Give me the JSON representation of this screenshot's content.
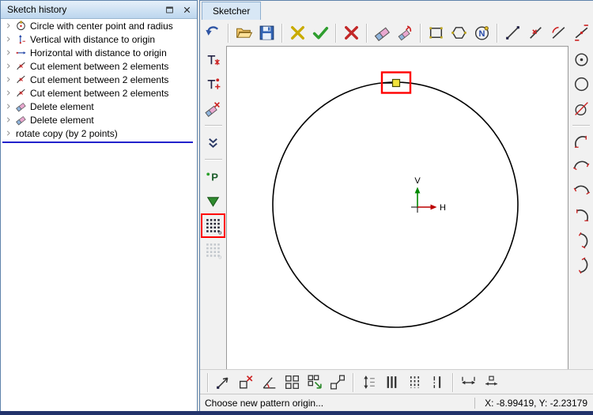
{
  "sketch_history": {
    "title": "Sketch history",
    "row_expand_icon": "expand-arrow",
    "window_buttons": [
      {
        "icon": "maximize"
      },
      {
        "icon": "close"
      }
    ],
    "items": [
      {
        "icon": "history-circle",
        "label": "Circle with center point and radius"
      },
      {
        "icon": "history-vertical",
        "label": "Vertical with distance to origin"
      },
      {
        "icon": "history-horizontal",
        "label": "Horizontal with distance to origin"
      },
      {
        "icon": "history-cut",
        "label": "Cut element between 2 elements"
      },
      {
        "icon": "history-cut",
        "label": "Cut element between 2 elements"
      },
      {
        "icon": "history-cut",
        "label": "Cut element between 2 elements"
      },
      {
        "icon": "history-delete",
        "label": "Delete element"
      },
      {
        "icon": "history-delete",
        "label": "Delete element"
      },
      {
        "icon": "none",
        "label": "rotate copy (by 2 points)"
      }
    ],
    "insertion_marker_color": "#2222cc"
  },
  "sketcher": {
    "title": "Sketcher",
    "toolbar_top": {
      "groups": [
        [
          "undo"
        ],
        [
          "open",
          "save"
        ],
        [
          "delete-yellow",
          "accept"
        ],
        [
          "cancel"
        ],
        [
          "eraser",
          "erase-marks"
        ],
        [
          "rect-tool",
          "polygon-tool",
          "spline-n-tool"
        ],
        [
          "line-tool",
          "line-cross-tool",
          "line-angle-tool",
          "line-edge-tool"
        ]
      ]
    },
    "toolbar_left": {
      "groups": [
        [
          "point-t1",
          "point-t2",
          "point-erase"
        ],
        [
          "collapse-double"
        ],
        [
          "point-p",
          "pattern-triangle",
          {
            "name": "pattern-grid",
            "highlight": true
          },
          {
            "name": "pattern-grid-alt",
            "disabled": true
          }
        ]
      ]
    },
    "toolbar_right": {
      "groups": [
        [
          "circle-center",
          "circle-plain",
          "circle-tangent"
        ],
        [
          "arc-r1",
          "arc-r2",
          "arc-r3",
          "arc-r4",
          "arc-r5",
          "arc-r6"
        ]
      ]
    },
    "toolbar_bottom": {
      "groups": [
        [],
        [
          "dim-move",
          "dim-delete",
          "dim-angle",
          "pattern-squares",
          "pattern-squares-arrow",
          "dim-scale"
        ],
        [
          "dim-vertical",
          "hatch-solid",
          "hatch-dashed",
          "hatch-axis"
        ],
        [
          "dim-linear",
          "dim-baseline"
        ]
      ]
    },
    "axes": {
      "v_label": "V",
      "h_label": "H"
    },
    "canvas": {
      "point_color": "#f2e33c",
      "highlight_color": "#ff0000",
      "circle_color": "#000000"
    },
    "statusbar": {
      "message": "Choose new pattern origin...",
      "coordinates": "X: -8.99419, Y: -2.23179"
    }
  },
  "colors": {
    "titlebar": "#bcd6ee",
    "tab": "#d8e7f5",
    "accent_red": "#ff0000",
    "insertion_blue": "#2222cc",
    "navy_bottom": "#22336b"
  }
}
